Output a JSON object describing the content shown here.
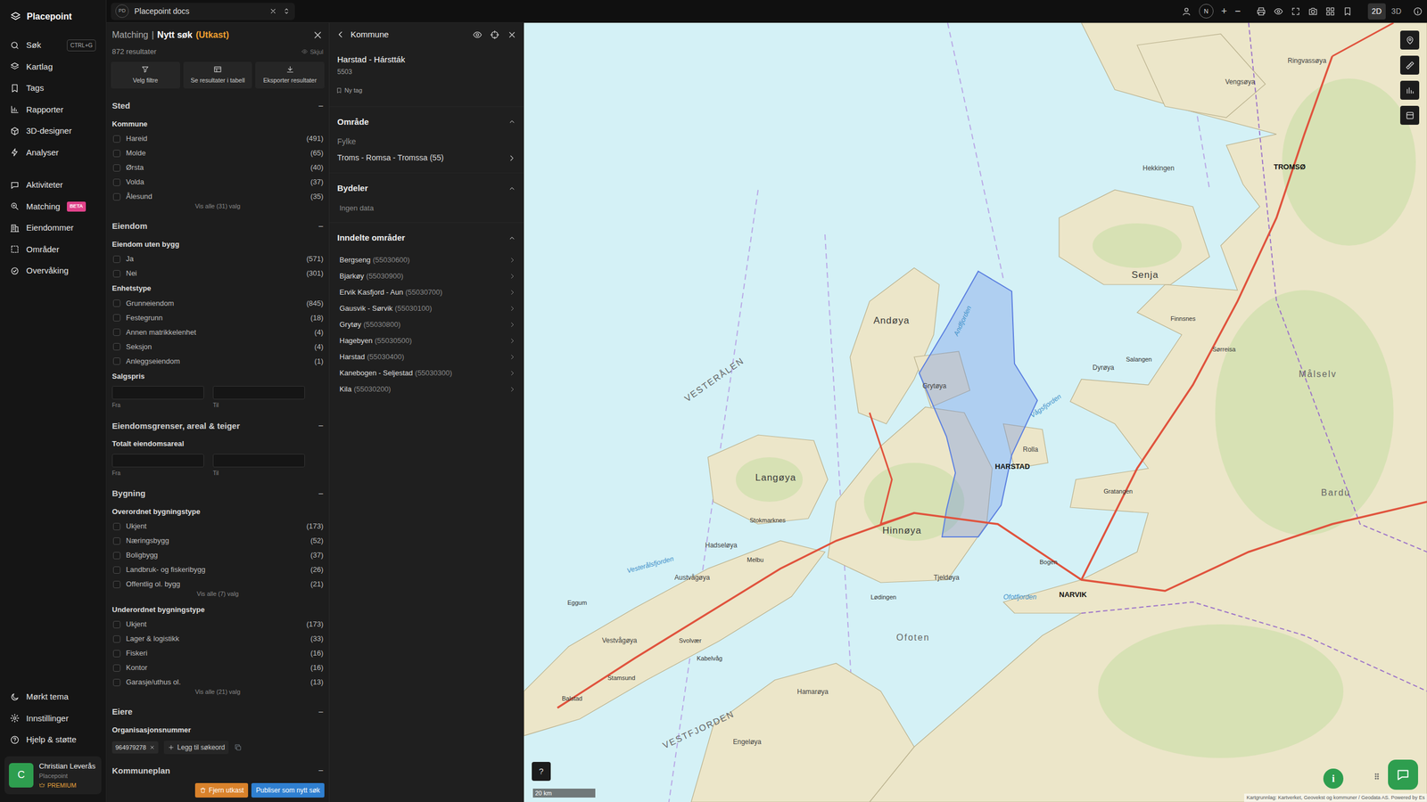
{
  "nav": {
    "brand": "Placepoint",
    "groups": [
      [
        {
          "label": "Søk",
          "shortcut": "CTRL+G"
        },
        {
          "label": "Kartlag"
        },
        {
          "label": "Tags"
        },
        {
          "label": "Rapporter"
        },
        {
          "label": "3D-designer"
        },
        {
          "label": "Analyser"
        }
      ],
      [
        {
          "label": "Aktiviteter"
        },
        {
          "label": "Matching",
          "badge": "BETA"
        },
        {
          "label": "Eiendommer"
        },
        {
          "label": "Områder"
        },
        {
          "label": "Overvåking"
        }
      ]
    ],
    "bottom": [
      {
        "label": "Mørkt tema"
      },
      {
        "label": "Innstillinger"
      },
      {
        "label": "Hjelp & støtte"
      }
    ],
    "user": {
      "initial": "C",
      "name": "Christian Leverås",
      "org": "Placepoint",
      "plan": "PREMIUM"
    }
  },
  "workspace": {
    "badge": "PD",
    "title": "Placepoint docs"
  },
  "toolbar": {
    "compass": "N",
    "zoom_in": "+",
    "zoom_out": "−",
    "modes": [
      {
        "label": "2D",
        "selected": true
      },
      {
        "label": "3D",
        "selected": false
      }
    ]
  },
  "filter": {
    "crumb": "Matching",
    "separator": "|",
    "title": "Nytt søk",
    "status": "(Utkast)",
    "results": "872 resultater",
    "hide": "Skjul",
    "actions": [
      {
        "label": "Velg filtre"
      },
      {
        "label": "Se resultater i tabell"
      },
      {
        "label": "Eksporter resultater"
      }
    ],
    "sections": [
      {
        "title": "Sted",
        "toggle": "−",
        "expanded": true,
        "groups": [
          {
            "kind": "checklist",
            "title": "Kommune",
            "options": [
              {
                "label": "Hareid",
                "count": "(491)",
                "checked": false
              },
              {
                "label": "Molde",
                "count": "(65)",
                "checked": false
              },
              {
                "label": "Ørsta",
                "count": "(40)",
                "checked": false
              },
              {
                "label": "Volda",
                "count": "(37)",
                "checked": false
              },
              {
                "label": "Ålesund",
                "count": "(35)",
                "checked": false
              }
            ],
            "more": "Vis alle (31) valg"
          }
        ]
      },
      {
        "title": "Eiendom",
        "toggle": "−",
        "expanded": true,
        "groups": [
          {
            "kind": "checklist",
            "title": "Eiendom uten bygg",
            "options": [
              {
                "label": "Ja",
                "count": "(571)",
                "checked": false
              },
              {
                "label": "Nei",
                "count": "(301)",
                "checked": false
              }
            ]
          },
          {
            "kind": "checklist",
            "title": "Enhetstype",
            "options": [
              {
                "label": "Grunneiendom",
                "count": "(845)",
                "checked": false
              },
              {
                "label": "Festegrunn",
                "count": "(18)",
                "checked": false
              },
              {
                "label": "Annen matrikkelenhet",
                "count": "(4)",
                "checked": false
              },
              {
                "label": "Seksjon",
                "count": "(4)",
                "checked": false
              },
              {
                "label": "Anleggseiendom",
                "count": "(1)",
                "checked": false
              }
            ]
          },
          {
            "kind": "range",
            "title": "Salgspris",
            "from": "Fra",
            "to": "Til"
          }
        ]
      },
      {
        "title": "Eiendomsgrenser, areal & teiger",
        "toggle": "−",
        "expanded": true,
        "groups": [
          {
            "kind": "range",
            "title": "Totalt eiendomsareal",
            "from": "Fra",
            "to": "Til"
          }
        ]
      },
      {
        "title": "Bygning",
        "toggle": "−",
        "expanded": true,
        "groups": [
          {
            "kind": "checklist",
            "title": "Overordnet bygningstype",
            "options": [
              {
                "label": "Ukjent",
                "count": "(173)",
                "checked": false
              },
              {
                "label": "Næringsbygg",
                "count": "(52)",
                "checked": false
              },
              {
                "label": "Boligbygg",
                "count": "(37)",
                "checked": false
              },
              {
                "label": "Landbruk- og fiskeribygg",
                "count": "(26)",
                "checked": false
              },
              {
                "label": "Offentlig ol. bygg",
                "count": "(21)",
                "checked": false
              }
            ],
            "more": "Vis alle (7) valg"
          },
          {
            "kind": "checklist",
            "title": "Underordnet bygningstype",
            "options": [
              {
                "label": "Ukjent",
                "count": "(173)",
                "checked": false
              },
              {
                "label": "Lager & logistikk",
                "count": "(33)",
                "checked": false
              },
              {
                "label": "Fiskeri",
                "count": "(16)",
                "checked": false
              },
              {
                "label": "Kontor",
                "count": "(16)",
                "checked": false
              },
              {
                "label": "Garasje/uthus ol.",
                "count": "(13)",
                "checked": false
              }
            ],
            "more": "Vis alle (21) valg"
          }
        ]
      },
      {
        "title": "Eiere",
        "toggle": "−",
        "expanded": true,
        "groups": [
          {
            "kind": "tags",
            "title": "Organisasjonsnummer",
            "tags": [
              "964979278"
            ],
            "add": "Legg til søkeord"
          }
        ]
      },
      {
        "title": "Kommuneplan",
        "toggle": "−",
        "expanded": true,
        "groups": []
      }
    ],
    "footer": {
      "discard": "Fjern utkast",
      "publish": "Publiser som nytt søk"
    }
  },
  "detail": {
    "heading": "Kommune",
    "name": "Harstad - Hárstták",
    "code": "5503",
    "tag": "Ny tag",
    "sections": [
      {
        "title": "Område",
        "expanded": true,
        "kind": "link",
        "label": "Fylke",
        "value": "Troms - Romsa - Tromssa (55)"
      },
      {
        "title": "Bydeler",
        "expanded": true,
        "kind": "empty",
        "value": "Ingen data"
      },
      {
        "title": "Inndelte områder",
        "expanded": true,
        "kind": "list",
        "items": [
          {
            "name": "Bergseng",
            "code": "(55030600)"
          },
          {
            "name": "Bjarkøy",
            "code": "(55030900)"
          },
          {
            "name": "Ervik Kasfjord - Aun",
            "code": "(55030700)"
          },
          {
            "name": "Gausvik - Sørvik",
            "code": "(55030100)"
          },
          {
            "name": "Grytøy",
            "code": "(55030800)"
          },
          {
            "name": "Hagebyen",
            "code": "(55030500)"
          },
          {
            "name": "Harstad",
            "code": "(55030400)"
          },
          {
            "name": "Kanebogen - Seljestad",
            "code": "(55030300)"
          },
          {
            "name": "Kila",
            "code": "(55030200)"
          }
        ]
      }
    ]
  },
  "map": {
    "labels": [
      {
        "text": "Andøya",
        "kind": "island-major"
      },
      {
        "text": "Senja",
        "kind": "island-major"
      },
      {
        "text": "Langøya",
        "kind": "island-major"
      },
      {
        "text": "Hinnøya",
        "kind": "island-major"
      },
      {
        "text": "HARSTAD",
        "kind": "town"
      },
      {
        "text": "NARVIK",
        "kind": "town"
      },
      {
        "text": "TROMSØ",
        "kind": "town"
      },
      {
        "text": "Målselv",
        "kind": "region"
      },
      {
        "text": "Bardu",
        "kind": "region"
      },
      {
        "text": "VESTERÅLEN",
        "kind": "region"
      },
      {
        "text": "Ofoten",
        "kind": "region"
      },
      {
        "text": "VESTFJORDEN",
        "kind": "region"
      },
      {
        "text": "Vestvågøya",
        "kind": "island"
      },
      {
        "text": "Austvågøya",
        "kind": "island"
      },
      {
        "text": "Hadseløya",
        "kind": "island"
      },
      {
        "text": "Grytøya",
        "kind": "island"
      },
      {
        "text": "Andfjorden",
        "kind": "water"
      },
      {
        "text": "Vågsfjorden",
        "kind": "water"
      },
      {
        "text": "Ofotfjorden",
        "kind": "water"
      },
      {
        "text": "Vesterålsfjorden",
        "kind": "water"
      },
      {
        "text": "Rolla",
        "kind": "island"
      },
      {
        "text": "Dyrøya",
        "kind": "island"
      },
      {
        "text": "Lødingen",
        "kind": "place"
      },
      {
        "text": "Melbu",
        "kind": "place"
      },
      {
        "text": "Stokmarknes",
        "kind": "place"
      },
      {
        "text": "Svolvær",
        "kind": "place"
      },
      {
        "text": "Kabelvåg",
        "kind": "place"
      },
      {
        "text": "Engeløya",
        "kind": "island"
      },
      {
        "text": "Hamarøya",
        "kind": "island"
      },
      {
        "text": "Tjeldøya",
        "kind": "island"
      },
      {
        "text": "Bogen",
        "kind": "place"
      },
      {
        "text": "Salangen",
        "kind": "place"
      },
      {
        "text": "Gratangen",
        "kind": "place"
      },
      {
        "text": "Sørreisa",
        "kind": "place"
      },
      {
        "text": "Finnsnes",
        "kind": "place"
      },
      {
        "text": "Eggum",
        "kind": "place"
      },
      {
        "text": "Stamsund",
        "kind": "place"
      },
      {
        "text": "Balstad",
        "kind": "place"
      },
      {
        "text": "Ringvassøya",
        "kind": "island"
      },
      {
        "text": "Vengsøya",
        "kind": "island"
      },
      {
        "text": "Hekkingen",
        "kind": "island"
      }
    ],
    "help": "?",
    "scale": "20 km",
    "info": "i",
    "attribution": "Kartgrunnlag: Kartverket, Geovekst og kommuner / Geodata AS. Powered by Es"
  }
}
